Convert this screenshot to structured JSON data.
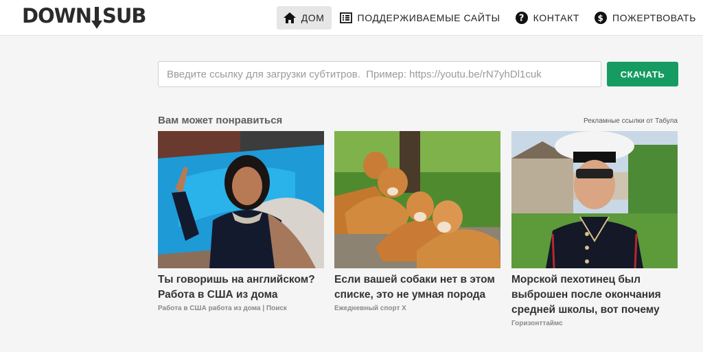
{
  "header": {
    "logo_text_left": "DOWN",
    "logo_text_right": "SUB",
    "nav": [
      {
        "label": "ДОМ",
        "icon": "home-icon",
        "active": true
      },
      {
        "label": "ПОДДЕРЖИВАЕМЫЕ САЙТЫ",
        "icon": "list-icon",
        "active": false
      },
      {
        "label": "КОНТАКТ",
        "icon": "help-icon",
        "active": false
      },
      {
        "label": "ПОЖЕРТВОВАТЬ",
        "icon": "dollar-icon",
        "active": false
      }
    ]
  },
  "search": {
    "value": "",
    "placeholder": "Введите ссылку для загрузки субтитров.  Пример: https://youtu.be/rN7yhDl1cuk",
    "button_label": "СКАЧАТЬ"
  },
  "recommendations": {
    "title": "Вам может понравиться",
    "sponsor": "Рекламные ссылки от Табула",
    "items": [
      {
        "headline": "Ты говоришь на английском? Работа в США из дома",
        "source": "Работа в США работа из дома | Поиск"
      },
      {
        "headline": "Если вашей собаки нет в этом списке, это не умная порода",
        "source": "Ежедневный спорт X"
      },
      {
        "headline": "Морской пехотинец был выброшен после окончания средней школы, вот почему",
        "source": "Горизонттаймс"
      }
    ]
  },
  "colors": {
    "accent": "#169b62",
    "nav_active": "#e6e6e6"
  }
}
